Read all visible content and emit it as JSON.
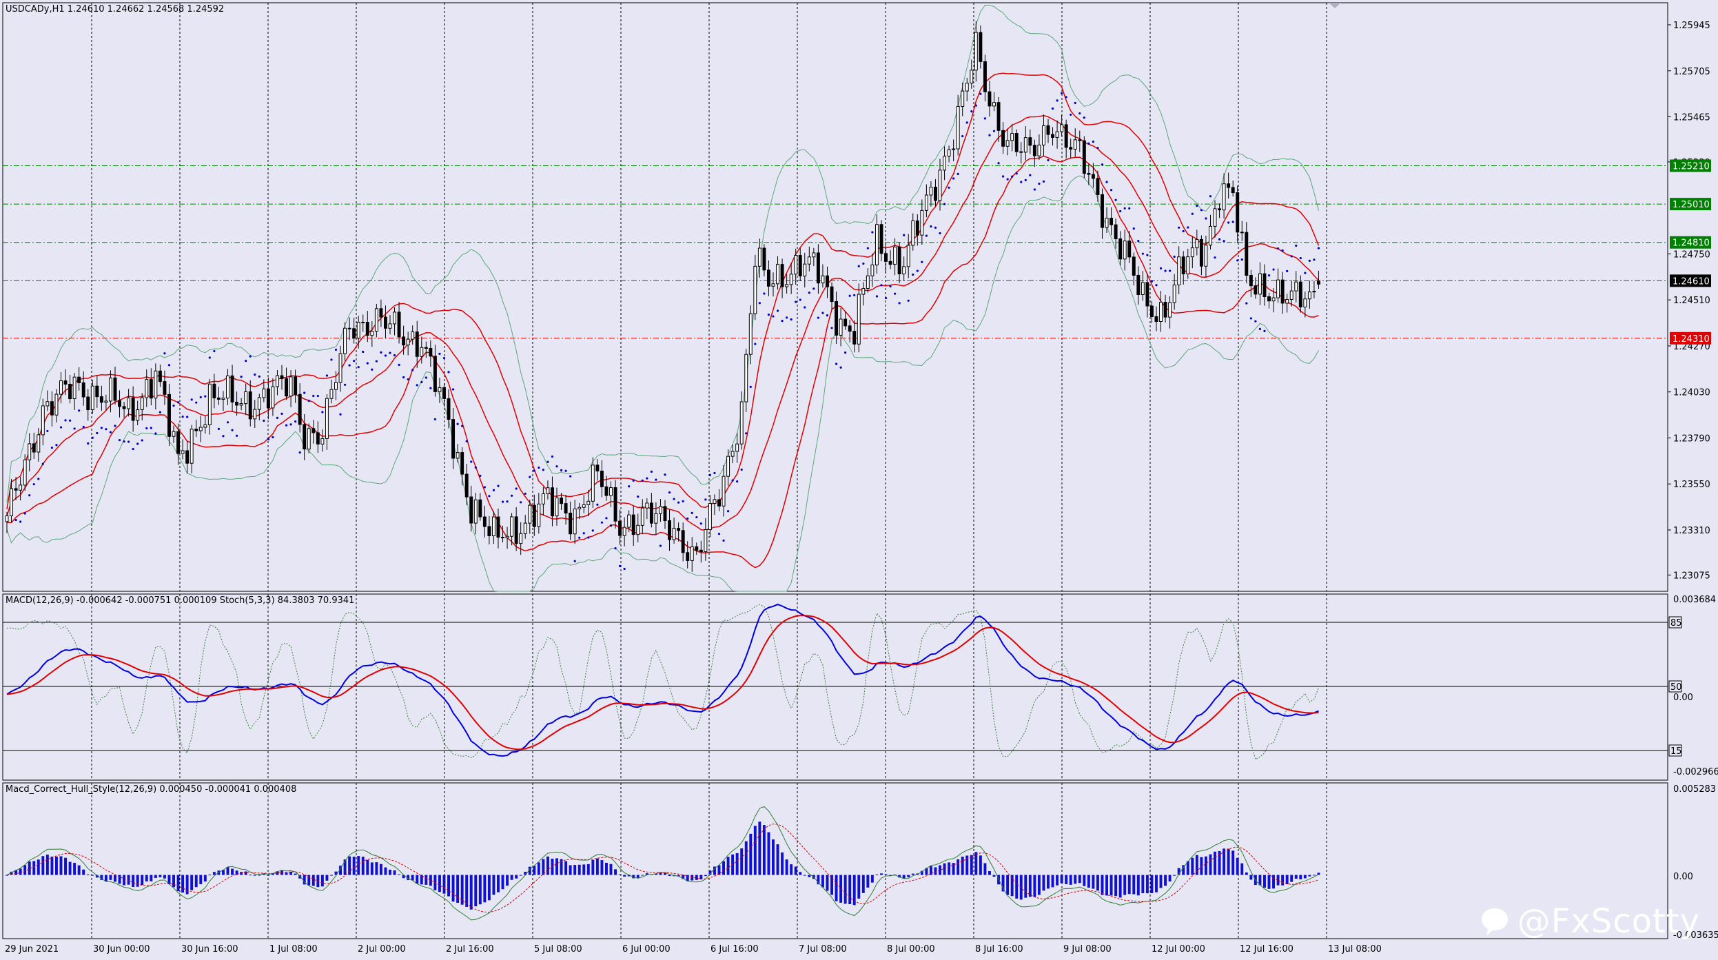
{
  "chart_info": {
    "symbol_header": "USDCADy,H1  1.24610 1.24662 1.24568 1.24592",
    "indicator1_header": "MACD(12,26,9) -0.000642 -0.000751 0.000109  Stoch(5,3,3) 84.3803 70.9341",
    "indicator2_header": "Macd_Correct_Hull_Style(12,26,9) 0.000450 -0.000041 0.000408"
  },
  "watermark": "@FxScotty",
  "colors": {
    "background": "#e6e6f5",
    "grid": "#000000",
    "bollinger_mid": "#e00000",
    "bollinger_outer": "#5aa878",
    "psar": "#0000cc",
    "macd_line": "#0000dd",
    "signal_line": "#e00000",
    "stoch": "#3c7f3c",
    "histogram": "#1010d0",
    "price_tag_current": "#000000",
    "price_tag_green": "#008000",
    "price_tag_red": "#e00000"
  },
  "price_axis": {
    "labels": [
      "1.25945",
      "1.25705",
      "1.25465",
      "1.25230",
      "1.24750",
      "1.24510",
      "1.24270",
      "1.24030",
      "1.23790",
      "1.23550",
      "1.23310",
      "1.23075"
    ]
  },
  "price_tags": [
    {
      "label": "1.25210",
      "value": 1.2521,
      "kind": "green"
    },
    {
      "label": "1.25010",
      "value": 1.2501,
      "kind": "green"
    },
    {
      "label": "1.24810",
      "value": 1.2481,
      "kind": "green"
    },
    {
      "label": "1.24610",
      "value": 1.2461,
      "kind": "current"
    },
    {
      "label": "1.24310",
      "value": 1.2431,
      "kind": "red"
    }
  ],
  "macd_axis": {
    "labels": [
      "0.003684",
      "85",
      "50",
      "0.00",
      "15",
      "-0.002966"
    ]
  },
  "hull_axis": {
    "labels": [
      "0.005283",
      "0.00",
      "-0.003635"
    ]
  },
  "time_axis": {
    "labels": [
      "29 Jun 2021",
      "30 Jun 00:00",
      "30 Jun 16:00",
      "1 Jul 08:00",
      "2 Jul 00:00",
      "2 Jul 16:00",
      "5 Jul 08:00",
      "6 Jul 00:00",
      "6 Jul 16:00",
      "7 Jul 08:00",
      "8 Jul 00:00",
      "8 Jul 16:00",
      "9 Jul 08:00",
      "12 Jul 00:00",
      "12 Jul 16:00",
      "13 Jul 08:00"
    ]
  },
  "chart_data": {
    "type": "candlestick",
    "symbol": "USDCADy",
    "timeframe": "H1",
    "price_range": [
      1.2299,
      1.2606
    ],
    "anchors": [
      [
        0,
        1.2335
      ],
      [
        8,
        1.2395
      ],
      [
        15,
        1.2405
      ],
      [
        22,
        1.2402
      ],
      [
        27,
        1.239
      ],
      [
        33,
        1.2415
      ],
      [
        38,
        1.2365
      ],
      [
        45,
        1.24
      ],
      [
        52,
        1.2398
      ],
      [
        58,
        1.2401
      ],
      [
        63,
        1.2407
      ],
      [
        66,
        1.2383
      ],
      [
        70,
        1.238
      ],
      [
        76,
        1.244
      ],
      [
        83,
        1.2438
      ],
      [
        92,
        1.243
      ],
      [
        98,
        1.2385
      ],
      [
        103,
        1.2345
      ],
      [
        108,
        1.2325
      ],
      [
        114,
        1.2335
      ],
      [
        120,
        1.2345
      ],
      [
        126,
        1.234
      ],
      [
        131,
        1.2358
      ],
      [
        136,
        1.2335
      ],
      [
        142,
        1.2338
      ],
      [
        148,
        1.2333
      ],
      [
        153,
        1.2315
      ],
      [
        158,
        1.235
      ],
      [
        163,
        1.2395
      ],
      [
        166,
        1.247
      ],
      [
        169,
        1.246
      ],
      [
        172,
        1.2465
      ],
      [
        176,
        1.247
      ],
      [
        180,
        1.2465
      ],
      [
        185,
        1.244
      ],
      [
        188,
        1.2435
      ],
      [
        193,
        1.248
      ],
      [
        196,
        1.2475
      ],
      [
        199,
        1.2472
      ],
      [
        205,
        1.2505
      ],
      [
        210,
        1.254
      ],
      [
        215,
        1.258
      ],
      [
        218,
        1.2555
      ],
      [
        222,
        1.2535
      ],
      [
        227,
        1.2525
      ],
      [
        232,
        1.2545
      ],
      [
        238,
        1.2525
      ],
      [
        242,
        1.2505
      ],
      [
        247,
        1.248
      ],
      [
        252,
        1.245
      ],
      [
        256,
        1.2445
      ],
      [
        261,
        1.2468
      ],
      [
        266,
        1.248
      ],
      [
        269,
        1.251
      ],
      [
        272,
        1.2505
      ],
      [
        275,
        1.246
      ],
      [
        280,
        1.2458
      ],
      [
        285,
        1.245
      ],
      [
        289,
        1.2452
      ],
      [
        291,
        1.2459
      ]
    ],
    "last_ohlc": {
      "open": 1.2461,
      "high": 1.24662,
      "low": 1.24568,
      "close": 1.24592
    },
    "indicators": {
      "bollinger_bands": {
        "color_mid": "red",
        "color_outer": "green"
      },
      "parabolic_sar": {
        "color": "blue"
      },
      "macd": {
        "params": [
          12,
          26,
          9
        ],
        "main": -0.000642,
        "signal": -0.000751,
        "hist": 0.000109
      },
      "stochastic": {
        "params": [
          5,
          3,
          3
        ],
        "k": 84.3803,
        "d": 70.9341,
        "levels": [
          85,
          50,
          15
        ]
      },
      "macd_hull": {
        "params": [
          12,
          26,
          9
        ],
        "values": [
          0.00045,
          -4.1e-05,
          0.000408
        ]
      }
    }
  }
}
